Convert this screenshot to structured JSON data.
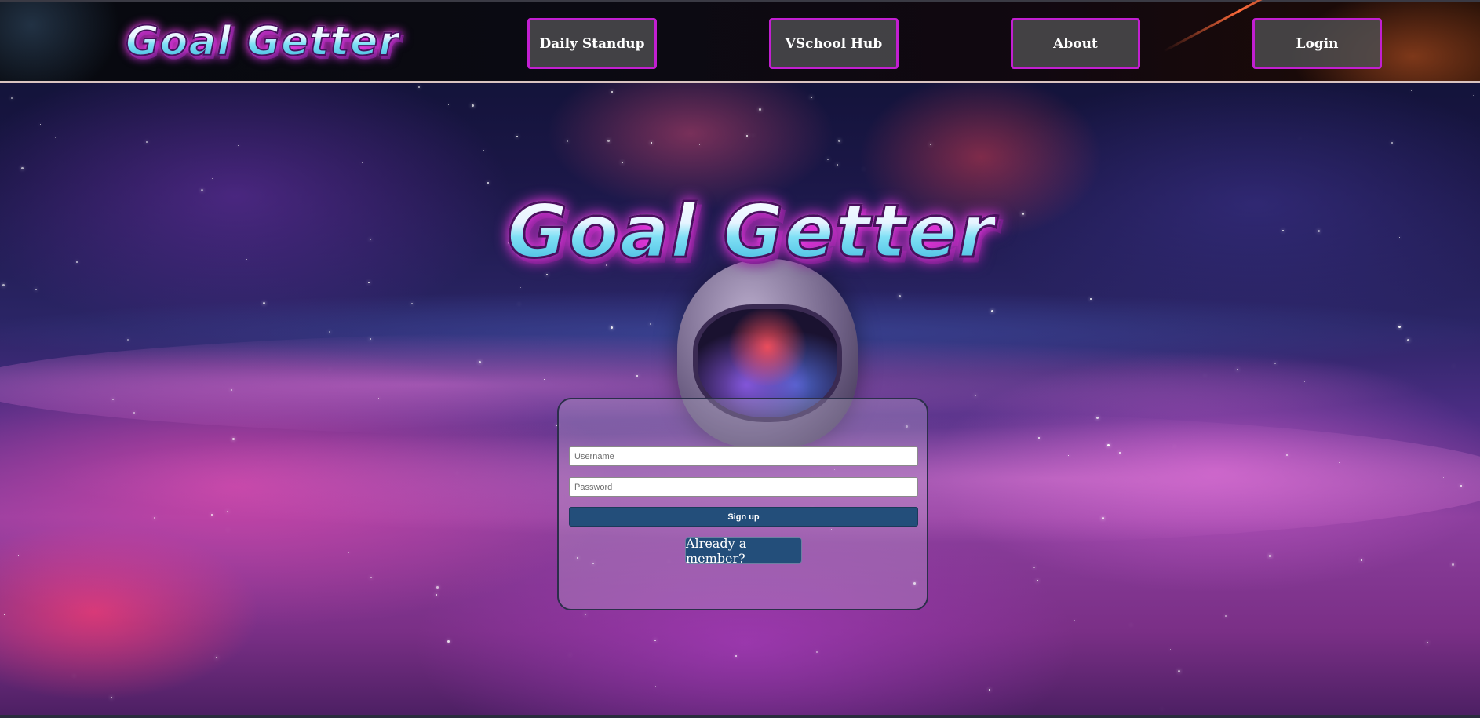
{
  "brand": {
    "name": "Goal Getter"
  },
  "nav": {
    "items": [
      {
        "label": "Daily Standup"
      },
      {
        "label": "VSchool Hub"
      },
      {
        "label": "About"
      },
      {
        "label": "Login"
      }
    ]
  },
  "hero": {
    "title": "Goal Getter"
  },
  "form": {
    "username_placeholder": "Username",
    "password_placeholder": "Password",
    "submit_label": "Sign up",
    "toggle_label": "Already a member?"
  },
  "colors": {
    "nav_button_border": "#c21fd1",
    "button_primary": "#234e7a",
    "logo_glow": "#ff3cf0"
  }
}
